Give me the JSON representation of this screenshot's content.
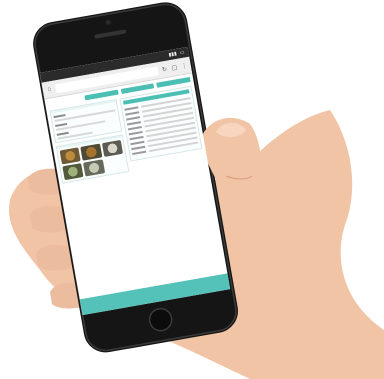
{
  "scene": {
    "description_tags": [
      "hand",
      "smartphone",
      "web-app-screen"
    ],
    "colors": {
      "background": "#ffffff",
      "skin": "#f0c4a5",
      "skin_shadow": "#d89a7a",
      "phone_body": "#151515",
      "screen_accent": "#4cbfb4"
    }
  }
}
